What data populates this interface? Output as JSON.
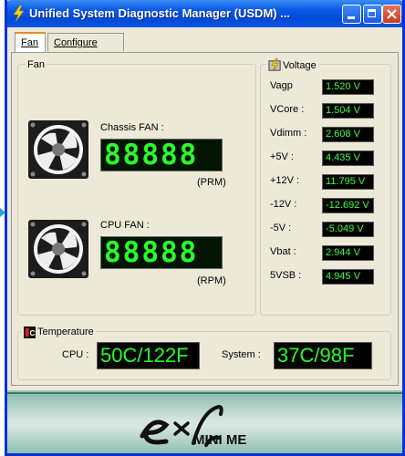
{
  "window": {
    "title": "Unified System Diagnostic Manager (USDM) ..."
  },
  "tabs": [
    {
      "label": "Fan",
      "active": true
    },
    {
      "label": "Configure",
      "active": false
    }
  ],
  "fan": {
    "group_label": "Fan",
    "chassis": {
      "label": "Chassis FAN :",
      "lcd": "88888",
      "unit": "(PRM)"
    },
    "cpu": {
      "label": "CPU FAN :",
      "lcd": "88888",
      "unit": "(RPM)"
    }
  },
  "voltage": {
    "group_label": "Voltage",
    "rows": [
      {
        "label": "Vagp",
        "value": "1.520 V"
      },
      {
        "label": "VCore :",
        "value": "1.504 V"
      },
      {
        "label": "Vdimm :",
        "value": "2.608 V"
      },
      {
        "label": "+5V :",
        "value": "4.435 V"
      },
      {
        "label": "+12V :",
        "value": "11.795 V"
      },
      {
        "label": "-12V :",
        "value": "-12.692 V"
      },
      {
        "label": "-5V :",
        "value": "-5.049 V"
      },
      {
        "label": "Vbat :",
        "value": "2.944 V"
      },
      {
        "label": "5VSB :",
        "value": "4.945 V"
      }
    ]
  },
  "temperature": {
    "group_label": "Temperature",
    "cpu_label": "CPU :",
    "cpu_value": "50C/122F",
    "system_label": "System :",
    "system_value": "37C/98F"
  },
  "banner": {
    "mini_text": "MINI ME"
  },
  "colors": {
    "lcd_green": "#2bff2b",
    "titlebar": "#0a5ae6",
    "dialog": "#ece9d8"
  }
}
